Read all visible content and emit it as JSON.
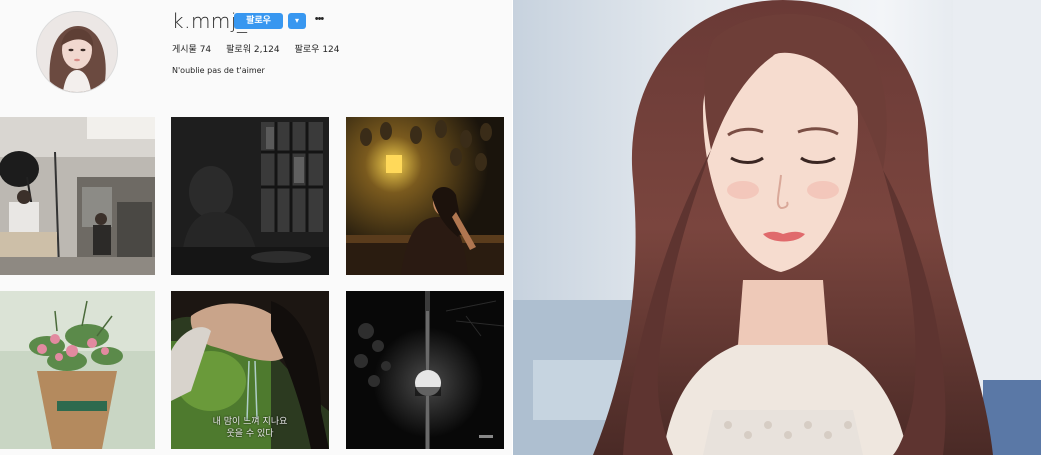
{
  "profile": {
    "username": "k.mmj_",
    "follow_label": "팔로우",
    "dropdown_label": "▾",
    "more_label": "•••",
    "stats": {
      "posts": "게시물 74",
      "followers": "팔로워 2,124",
      "following": "팔로우 124"
    },
    "bio": "N'oublie pas de t'aimer"
  },
  "grid": {
    "posts": [
      {
        "subject": "photo studio"
      },
      {
        "subject": "dark window portrait"
      },
      {
        "subject": "cafe lamp portrait"
      },
      {
        "subject": "flower bouquet"
      },
      {
        "subject": "face in water"
      },
      {
        "subject": "night moon"
      }
    ],
    "caption_line1": "내 맘이 느껴 지나요",
    "caption_line2": "웃을 수 있다"
  },
  "colors": {
    "accent": "#3897f0",
    "text": "#262626",
    "panel_bg": "#fafafa"
  }
}
